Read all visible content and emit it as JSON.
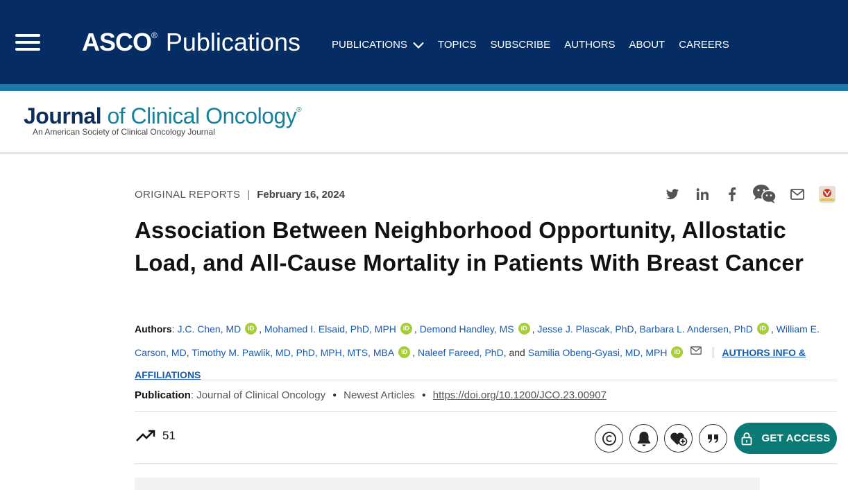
{
  "header": {
    "menu_icon": "hamburger-icon",
    "brand_asco": "ASCO",
    "brand_reg": "®",
    "brand_publications": "Publications",
    "nav": [
      {
        "label": "PUBLICATIONS",
        "has_dropdown": true
      },
      {
        "label": "TOPICS"
      },
      {
        "label": "SUBSCRIBE"
      },
      {
        "label": "AUTHORS"
      },
      {
        "label": "ABOUT"
      },
      {
        "label": "CAREERS"
      }
    ],
    "colors": {
      "navy": "#052d63",
      "stripe": "#1b78a8"
    }
  },
  "journal": {
    "title_part1": "Journal",
    "title_part2": " of Clinical Oncology",
    "reg": "®",
    "subtitle": "An American Society of Clinical Oncology Journal"
  },
  "article": {
    "category": "ORIGINAL REPORTS",
    "separator": "|",
    "date": "February 16, 2024",
    "title": "Association Between Neighborhood Opportunity, Allostatic Load, and All-Cause Mortality in Patients With Breast Cancer",
    "share_icons": [
      "twitter-icon",
      "linkedin-icon",
      "facebook-icon",
      "wechat-icon",
      "email-icon",
      "mendeley-icon"
    ],
    "authors_label": "Authors",
    "authors": [
      "J.C. Chen, MD",
      "Mohamed I. Elsaid, PhD, MPH",
      "Demond Handley, MS",
      "Jesse J. Plascak, PhD",
      "Barbara L. Andersen, PhD",
      "William E. Carson, MD",
      "Timothy M. Pawlik, MD, PhD, MPH, MTS, MBA",
      "Naleef Fareed, PhD",
      "Samilia Obeng-Gyasi, MD, MPH"
    ],
    "orcid_label": "iD",
    "and_text": "and",
    "affiliations_link": "AUTHORS INFO & AFFILIATIONS",
    "publication_label": "Publication",
    "publication_journal": "Journal of Clinical Oncology",
    "publication_section": "Newest Articles",
    "doi": "https://doi.org/10.1200/JCO.23.00907",
    "metric_count": "51",
    "action_icons": [
      "copyright-icon",
      "bell-icon",
      "heart-plus-icon",
      "quote-icon"
    ],
    "get_access_label": "GET ACCESS",
    "accent_color": "#0b7a74"
  }
}
